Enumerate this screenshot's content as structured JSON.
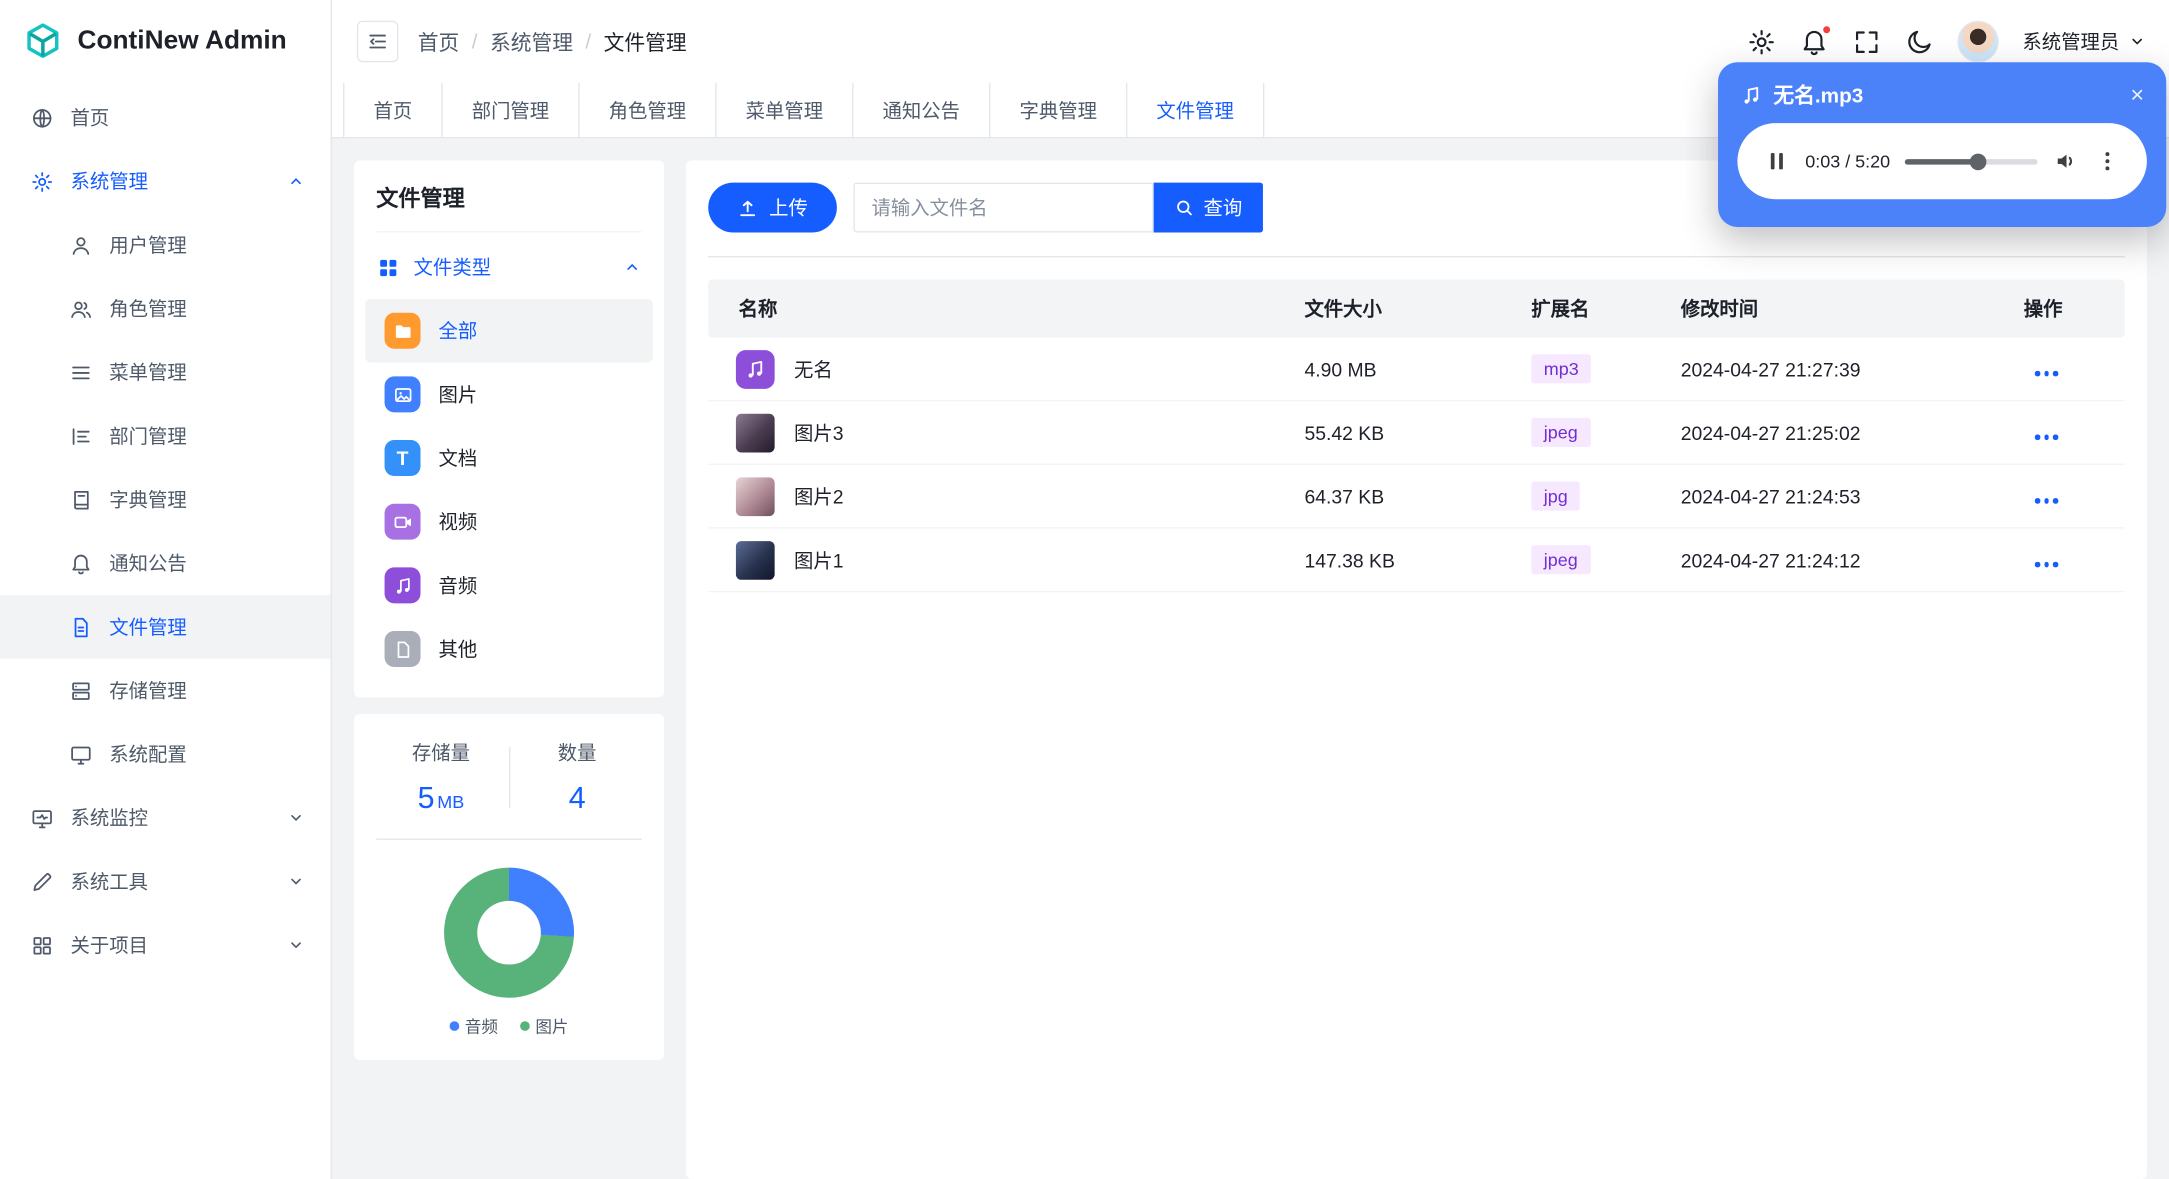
{
  "app": {
    "title": "ContiNew Admin"
  },
  "header": {
    "breadcrumb": [
      "首页",
      "系统管理",
      "文件管理"
    ],
    "user_name": "系统管理员"
  },
  "tabs": [
    "首页",
    "部门管理",
    "角色管理",
    "菜单管理",
    "通知公告",
    "字典管理",
    "文件管理"
  ],
  "sidebar": {
    "home": "首页",
    "system": "系统管理",
    "system_children": [
      "用户管理",
      "角色管理",
      "菜单管理",
      "部门管理",
      "字典管理",
      "通知公告",
      "文件管理",
      "存储管理",
      "系统配置"
    ],
    "monitor": "系统监控",
    "tools": "系统工具",
    "about": "关于项目"
  },
  "filter_panel": {
    "title": "文件管理",
    "group_label": "文件类型",
    "types": [
      "全部",
      "图片",
      "文档",
      "视频",
      "音频",
      "其他"
    ],
    "stats": {
      "storage_label": "存储量",
      "storage_value": "5",
      "storage_unit": "MB",
      "count_label": "数量",
      "count_value": "4"
    },
    "legend": [
      "音频",
      "图片"
    ]
  },
  "toolbar": {
    "upload_label": "上传",
    "search_placeholder": "请输入文件名",
    "query_label": "查询"
  },
  "table": {
    "headers": [
      "名称",
      "文件大小",
      "扩展名",
      "修改时间",
      "操作"
    ],
    "rows": [
      {
        "name": "无名",
        "size": "4.90 MB",
        "ext": "mp3",
        "time": "2024-04-27 21:27:39"
      },
      {
        "name": "图片3",
        "size": "55.42 KB",
        "ext": "jpeg",
        "time": "2024-04-27 21:25:02"
      },
      {
        "name": "图片2",
        "size": "64.37 KB",
        "ext": "jpg",
        "time": "2024-04-27 21:24:53"
      },
      {
        "name": "图片1",
        "size": "147.38 KB",
        "ext": "jpeg",
        "time": "2024-04-27 21:24:12"
      }
    ]
  },
  "player": {
    "title": "无名.mp3",
    "time": "0:03 / 5:20"
  },
  "donut": {
    "audio_pct": 26,
    "image_pct": 74
  },
  "colors": {
    "primary": "#165DFF",
    "player_blue": "#4B82F9",
    "badge_bg": "#F5E8FF",
    "badge_text": "#722ED1",
    "chart_audio_blue": "#4080FF",
    "chart_image_green": "#57B37A",
    "notification_red": "#F53F3F",
    "logo_teal": "#13C2C2"
  }
}
